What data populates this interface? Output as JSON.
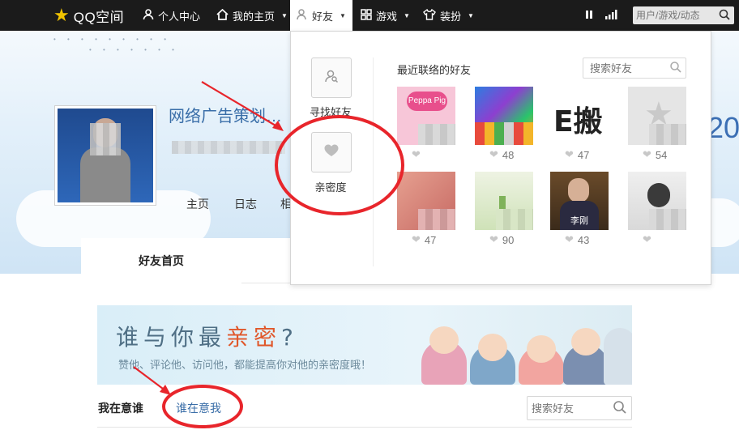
{
  "topbar": {
    "logo_text": "QQ空间",
    "nav": [
      {
        "label": "个人中心",
        "icon": "person-icon"
      },
      {
        "label": "我的主页",
        "icon": "home-icon"
      },
      {
        "label": "好友",
        "icon": "friends-icon"
      },
      {
        "label": "游戏",
        "icon": "grid-icon"
      },
      {
        "label": "装扮",
        "icon": "shirt-icon"
      }
    ],
    "search_placeholder": "用户/游戏/动态"
  },
  "profile": {
    "name": "网络广告策划…",
    "tabs": [
      "主页",
      "日志",
      "相"
    ],
    "big_text": "20"
  },
  "main": {
    "tab_label": "好友首页",
    "banner_title_a": "谁与你最",
    "banner_title_b": "亲密",
    "banner_title_c": "?",
    "banner_sub": "赞他、评论他、访问他，都能提高你对他的亲密度哦！",
    "subtab_active": "我在意谁",
    "subtab_other": "谁在意我",
    "search_placeholder": "搜索好友"
  },
  "dropdown": {
    "find_friends": "寻找好友",
    "intimacy": "亲密度",
    "recent_title": "最近联络的好友",
    "search_placeholder": "搜索好友",
    "friends": [
      {
        "score": "",
        "thumb_label": "Peppa Pig"
      },
      {
        "score": "48",
        "thumb_label": ""
      },
      {
        "score": "47",
        "thumb_label": "E搬"
      },
      {
        "score": "54",
        "thumb_label": ""
      },
      {
        "score": "47",
        "thumb_label": ""
      },
      {
        "score": "90",
        "thumb_label": ""
      },
      {
        "score": "43",
        "thumb_label": "李刚"
      },
      {
        "score": "",
        "thumb_label": ""
      }
    ]
  },
  "colors": {
    "topbar": "#1b1b1b",
    "brand_yellow": "#f2c400",
    "link_blue": "#3a6ea8",
    "annotation_red": "#e8252b"
  }
}
